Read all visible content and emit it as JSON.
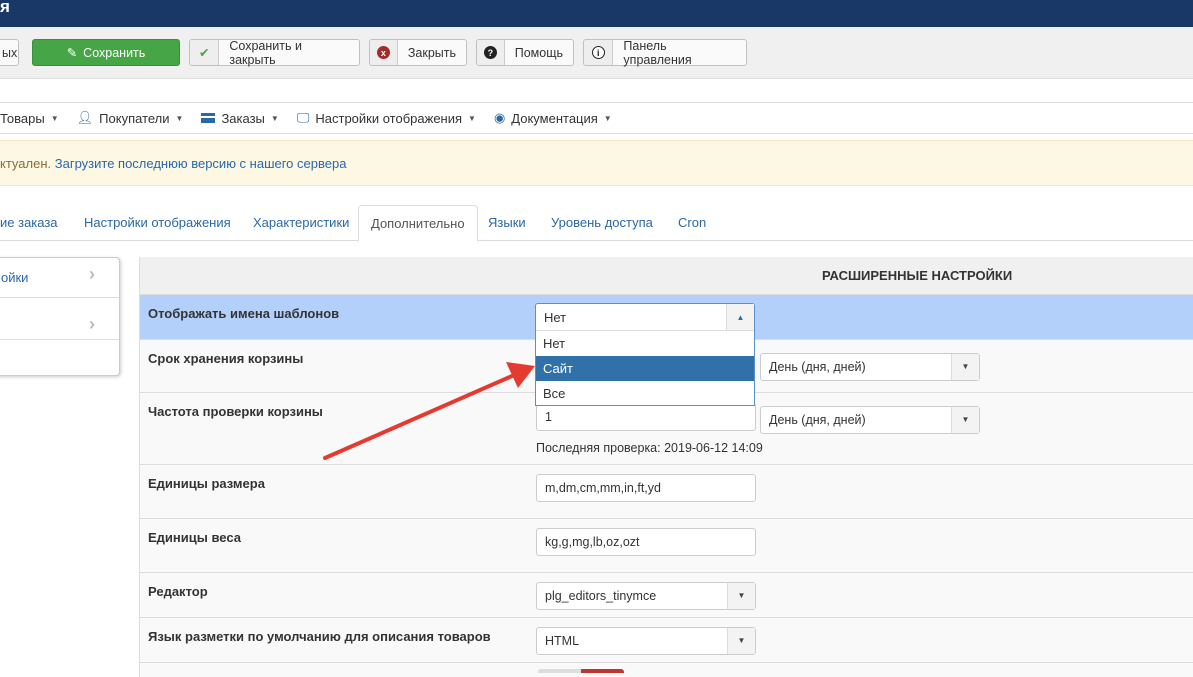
{
  "window": {
    "title": "я"
  },
  "toolbar": {
    "partial": "ых",
    "save": "Сохранить",
    "save_close": "Сохранить и закрыть",
    "close": "Закрыть",
    "help": "Помощь",
    "panel": "Панель управления"
  },
  "menu": [
    {
      "label": "Товары"
    },
    {
      "label": "Покупатели"
    },
    {
      "label": "Заказы"
    },
    {
      "label": "Настройки отображения"
    },
    {
      "label": "Документация"
    }
  ],
  "alert": {
    "text": "ктуален. ",
    "link": "Загрузите последнюю версию с нашего сервера"
  },
  "tabs": [
    "ие заказа",
    "Настройки отображения",
    "Характеристики",
    "Дополнительно",
    "Языки",
    "Уровень доступа",
    "Cron"
  ],
  "sidebar": {
    "item1": "ойки"
  },
  "section": {
    "title": "РАСШИРЕННЫЕ НАСТРОЙКИ"
  },
  "rows": [
    {
      "label": "Отображать имена шаблонов",
      "value": "Нет"
    },
    {
      "label": "Срок хранения корзины",
      "unit": "День (дня, дней)"
    },
    {
      "label": "Частота проверки корзины",
      "value": "1",
      "unit": "День (дня, дней)",
      "note": "Последняя проверка: 2019-06-12 14:09"
    },
    {
      "label": "Единицы размера",
      "value": "m,dm,cm,mm,in,ft,yd"
    },
    {
      "label": "Единицы веса",
      "value": "kg,g,mg,lb,oz,ozt"
    },
    {
      "label": "Редактор",
      "value": "plg_editors_tinymce"
    },
    {
      "label": "Язык разметки по умолчанию для описания товаров",
      "value": "HTML"
    }
  ],
  "dropdown": {
    "options": [
      "Нет",
      "Сайт",
      "Все"
    ],
    "highlighted": "Сайт"
  }
}
